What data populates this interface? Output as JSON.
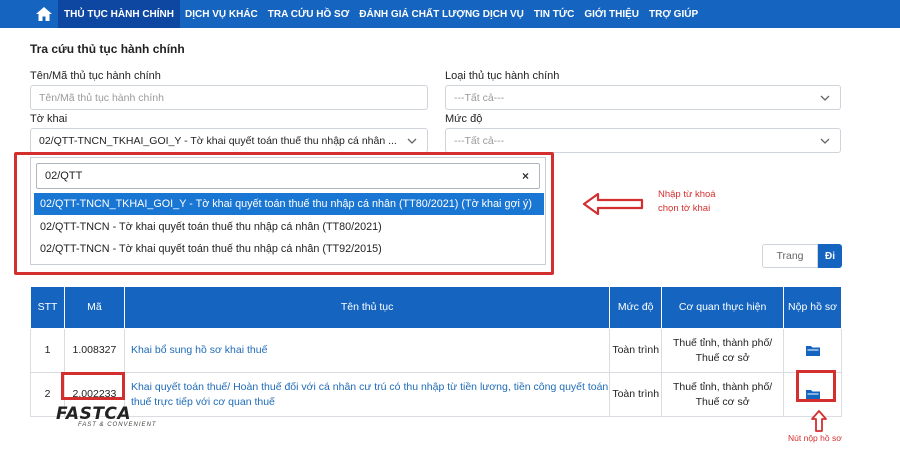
{
  "nav": {
    "items": [
      "THỦ TỤC HÀNH CHÍNH",
      "DỊCH VỤ KHÁC",
      "TRA CỨU HỒ SƠ",
      "ĐÁNH GIÁ CHẤT LƯỢNG DỊCH VỤ",
      "TIN TỨC",
      "GIỚI THIỆU",
      "TRỢ GIÚP"
    ],
    "home_icon": "home-icon"
  },
  "form": {
    "title": "Tra cứu thủ tục hành chính",
    "name_label": "Tên/Mã thủ tục hành chính",
    "name_placeholder": "Tên/Mã thủ tục hành chính",
    "type_label": "Loại thủ tục hành chính",
    "type_value": "---Tất cả---",
    "form_label": "Tờ khai",
    "form_value": "02/QTT-TNCN_TKHAI_GOI_Y - Tờ khai quyết toán thuế thu nhập cá nhân ...",
    "level_label": "Mức độ",
    "level_value": "---Tất cả---"
  },
  "dropdown": {
    "search_value": "02/QTT",
    "clear_symbol": "×",
    "options": [
      "02/QTT-TNCN_TKHAI_GOI_Y - Tờ khai quyết toán thuế thu nhập cá nhân (TT80/2021) (Tờ khai gợi ý)",
      "02/QTT-TNCN - Tờ khai quyết toán thuế thu nhập cá nhân (TT80/2021)",
      "02/QTT-TNCN - Tờ khai quyết toán thuế thu nhập cá nhân (TT92/2015)"
    ],
    "highlighted_index": 0
  },
  "annotation": {
    "line1": "Nhập từ khoá",
    "line2": "chọn tờ khai"
  },
  "pagination": {
    "page_label": "Trang",
    "go_label": "Đi"
  },
  "table": {
    "headers": [
      "STT",
      "Mã",
      "Tên thủ tục",
      "Mức độ",
      "Cơ quan thực hiện",
      "Nộp hồ sơ"
    ],
    "rows": [
      {
        "stt": "1",
        "code": "1.008327",
        "name": "Khai bổ sung hồ sơ khai thuế",
        "level": "Toàn trình",
        "agency": "Thuế tỉnh, thành phố/ Thuế cơ sở"
      },
      {
        "stt": "2",
        "code": "2.002233",
        "name": "Khai quyết toán thuế/ Hoàn thuế đối với cá nhân cư trú có thu nhập từ tiền lương, tiền công quyết toán thuế trực tiếp với cơ quan thuế",
        "level": "Toàn trình",
        "agency": "Thuế tỉnh, thành phố/ Thuế cơ sở"
      }
    ]
  },
  "logo": {
    "main": "FASTCA",
    "tagline": "FAST & CONVENIENT"
  },
  "submit_caption": "Nút nộp hồ sơ",
  "colors": {
    "primary": "#1565c0",
    "highlight": "#1976d2",
    "annotation_red": "#d32f2f",
    "link": "#1e6bb8"
  }
}
